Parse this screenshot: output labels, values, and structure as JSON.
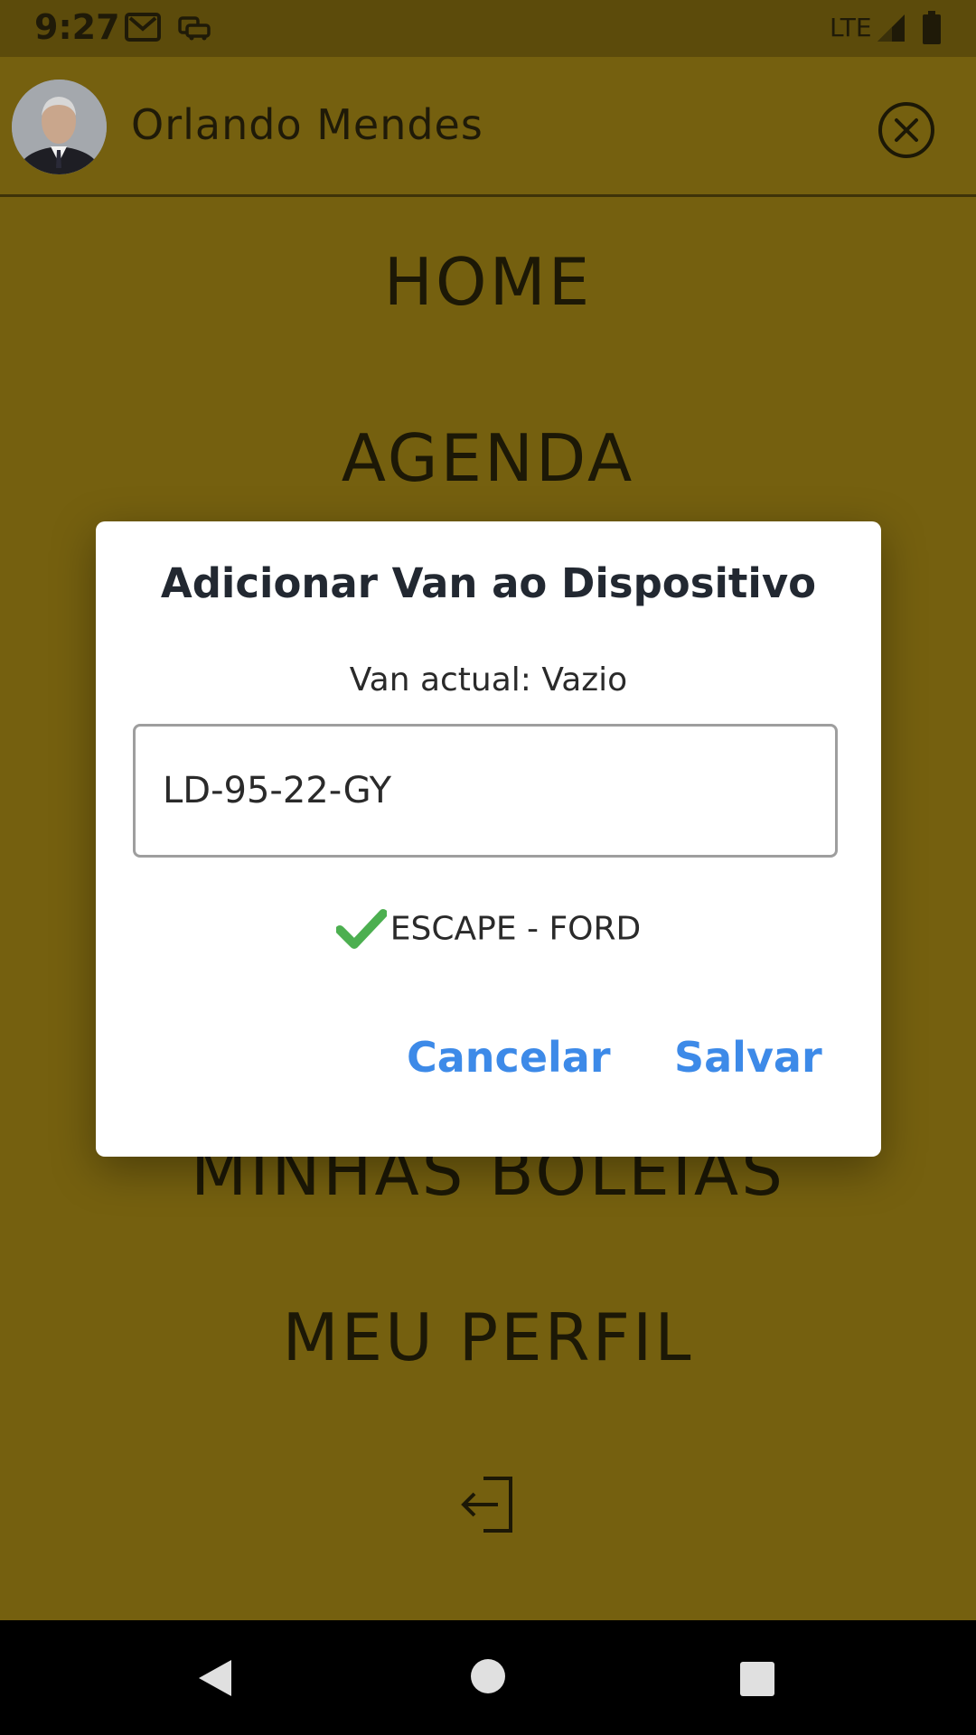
{
  "status_bar": {
    "time": "9:27",
    "network": "LTE",
    "icons": [
      "gmail-icon",
      "car-icon",
      "signal-icon",
      "battery-icon"
    ]
  },
  "header": {
    "user_name": "Orlando Mendes",
    "close_icon": "close-circle-icon"
  },
  "menu": {
    "home": "HOME",
    "agenda": "AGENDA",
    "boleias": "MINHAS BOLEIAS",
    "perfil": "MEU PERFIL",
    "logout_icon": "logout-icon"
  },
  "dialog": {
    "title": "Adicionar Van ao Dispositivo",
    "current_van": "Van actual: Vazio",
    "plate_value": "LD-95-22-GY",
    "vehicle_info": "ESCAPE - FORD",
    "cancel_label": "Cancelar",
    "save_label": "Salvar"
  },
  "colors": {
    "background": "#75600f",
    "status_bar": "#5c4b0b",
    "accent": "#3d8ae8",
    "check": "#4caf50"
  }
}
